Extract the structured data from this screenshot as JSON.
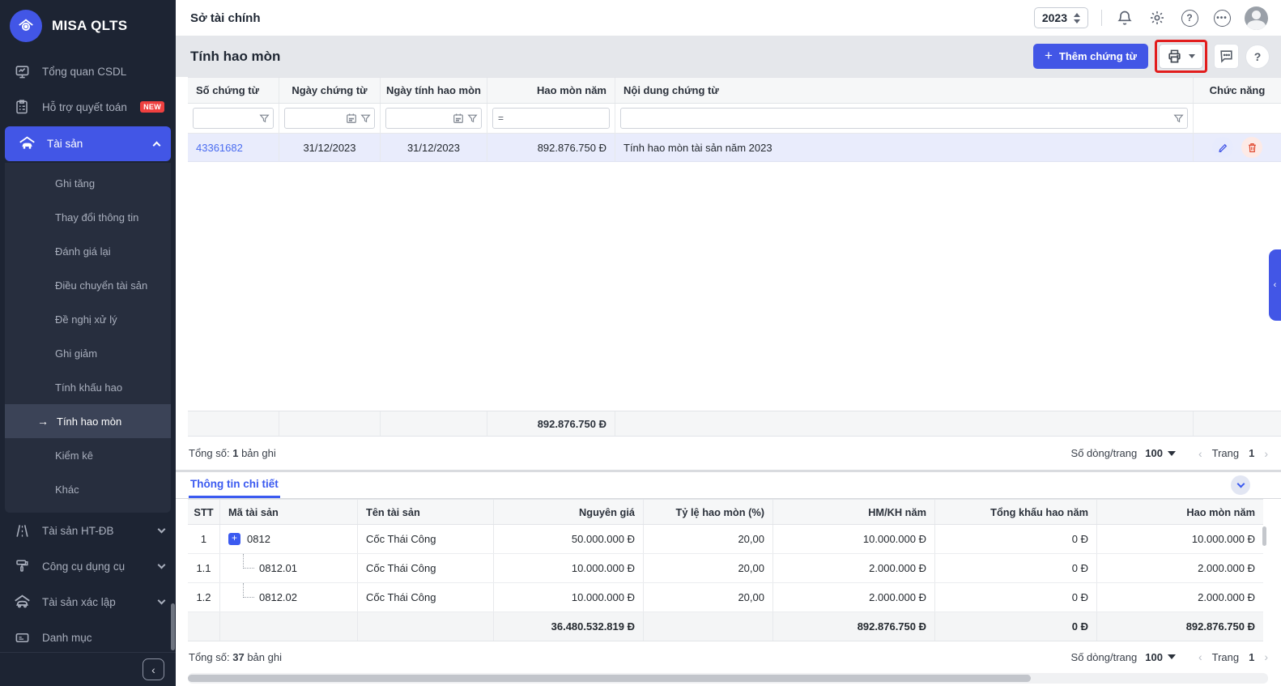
{
  "app": {
    "brand": "MISA QLTS",
    "unit_name": "Sở tài chính",
    "year": "2023"
  },
  "sidebar": {
    "items_top": [
      {
        "label": "Tổng quan CSDL"
      },
      {
        "label": "Hỗ trợ quyết toán",
        "badge": "NEW"
      },
      {
        "label": "Tài sản"
      }
    ],
    "asset_submenu": [
      {
        "label": "Ghi tăng"
      },
      {
        "label": "Thay đổi thông tin"
      },
      {
        "label": "Đánh giá lại"
      },
      {
        "label": "Điều chuyển tài sản"
      },
      {
        "label": "Đề nghị xử lý"
      },
      {
        "label": "Ghi giảm"
      },
      {
        "label": "Tính khấu hao"
      },
      {
        "label": "Tính hao mòn"
      },
      {
        "label": "Kiểm kê"
      },
      {
        "label": "Khác"
      }
    ],
    "items_bottom": [
      {
        "label": "Tài sản HT-ĐB"
      },
      {
        "label": "Công cụ dụng cụ"
      },
      {
        "label": "Tài sản xác lập"
      },
      {
        "label": "Danh mục"
      }
    ]
  },
  "page": {
    "title": "Tính hao mòn",
    "add_button": "Thêm chứng từ"
  },
  "vouchers": {
    "columns": [
      "Số chứng từ",
      "Ngày chứng từ",
      "Ngày tính hao mòn",
      "Hao mòn năm",
      "Nội dung chứng từ",
      "Chức năng"
    ],
    "filter_equals": "=",
    "rows": [
      {
        "so_chung_tu": "43361682",
        "ngay_chung_tu": "31/12/2023",
        "ngay_tinh_hao_mon": "31/12/2023",
        "hao_mon_nam": "892.876.750 Đ",
        "noi_dung": "Tính hao mòn tài sản năm 2023"
      }
    ],
    "total_hao_mon_nam": "892.876.750 Đ",
    "footer": {
      "total_label": "Tổng số:",
      "count": "1",
      "records_suffix": "bản ghi",
      "per_page_label": "Số dòng/trang",
      "per_page": "100",
      "page_label": "Trang",
      "page": "1"
    }
  },
  "details": {
    "tab": "Thông tin chi tiết",
    "columns": [
      "STT",
      "Mã tài sản",
      "Tên tài sản",
      "Nguyên giá",
      "Tỷ lệ hao mòn (%)",
      "HM/KH năm",
      "Tổng khấu hao năm",
      "Hao mòn năm"
    ],
    "rows": [
      {
        "stt": "1",
        "ma": "0812",
        "ten": "Cốc Thái Công",
        "nguyen_gia": "50.000.000 Đ",
        "ty_le": "20,00",
        "hm_kh_nam": "10.000.000 Đ",
        "tong_khau_hao_nam": "0 Đ",
        "hao_mon_nam": "10.000.000 Đ"
      },
      {
        "stt": "1.1",
        "ma": "0812.01",
        "ten": "Cốc Thái Công",
        "nguyen_gia": "10.000.000 Đ",
        "ty_le": "20,00",
        "hm_kh_nam": "2.000.000 Đ",
        "tong_khau_hao_nam": "0 Đ",
        "hao_mon_nam": "2.000.000 Đ"
      },
      {
        "stt": "1.2",
        "ma": "0812.02",
        "ten": "Cốc Thái Công",
        "nguyen_gia": "10.000.000 Đ",
        "ty_le": "20,00",
        "hm_kh_nam": "2.000.000 Đ",
        "tong_khau_hao_nam": "0 Đ",
        "hao_mon_nam": "2.000.000 Đ"
      }
    ],
    "totals": {
      "nguyen_gia": "36.480.532.819 Đ",
      "hm_kh_nam": "892.876.750 Đ",
      "tong_khau_hao_nam": "0 Đ",
      "hao_mon_nam": "892.876.750 Đ"
    },
    "footer": {
      "total_label": "Tổng số:",
      "count": "37",
      "records_suffix": "bản ghi",
      "per_page_label": "Số dòng/trang",
      "per_page": "100",
      "page_label": "Trang",
      "page": "1"
    }
  }
}
